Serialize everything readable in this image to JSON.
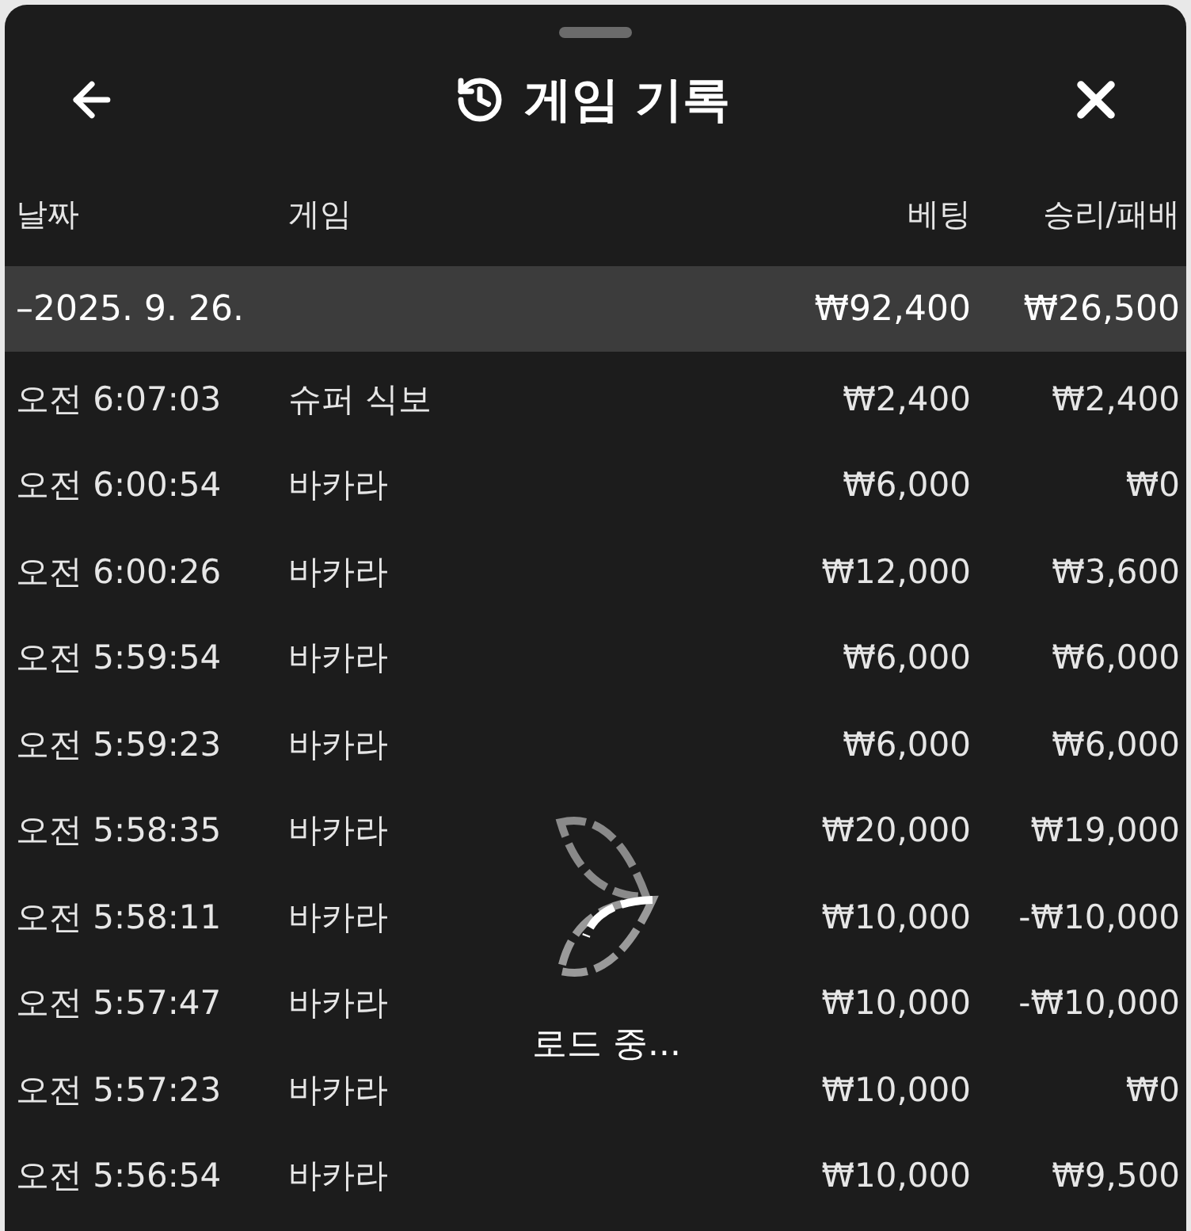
{
  "header": {
    "title": "게임 기록"
  },
  "table": {
    "columns": [
      "날짜",
      "게임",
      "베팅",
      "승리/패배"
    ],
    "summary": {
      "date": "–2025. 9. 26.",
      "bet": "₩92,400",
      "result": "₩26,500"
    },
    "rows": [
      {
        "time": "오전 6:07:03",
        "game": "슈퍼 식보",
        "bet": "₩2,400",
        "result": "₩2,400"
      },
      {
        "time": "오전 6:00:54",
        "game": "바카라",
        "bet": "₩6,000",
        "result": "₩0"
      },
      {
        "time": "오전 6:00:26",
        "game": "바카라",
        "bet": "₩12,000",
        "result": "₩3,600"
      },
      {
        "time": "오전 5:59:54",
        "game": "바카라",
        "bet": "₩6,000",
        "result": "₩6,000"
      },
      {
        "time": "오전 5:59:23",
        "game": "바카라",
        "bet": "₩6,000",
        "result": "₩6,000"
      },
      {
        "time": "오전 5:58:35",
        "game": "바카라",
        "bet": "₩20,000",
        "result": "₩19,000"
      },
      {
        "time": "오전 5:58:11",
        "game": "바카라",
        "bet": "₩10,000",
        "result": "-₩10,000"
      },
      {
        "time": "오전 5:57:47",
        "game": "바카라",
        "bet": "₩10,000",
        "result": "-₩10,000"
      },
      {
        "time": "오전 5:57:23",
        "game": "바카라",
        "bet": "₩10,000",
        "result": "₩0"
      },
      {
        "time": "오전 5:56:54",
        "game": "바카라",
        "bet": "₩10,000",
        "result": "₩9,500"
      }
    ]
  },
  "loading": {
    "label": "로드 중..."
  }
}
